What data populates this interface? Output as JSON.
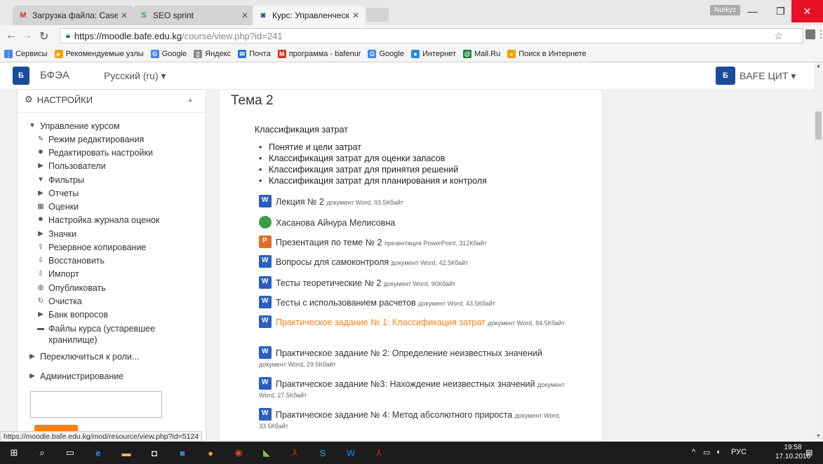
{
  "browser": {
    "tabs": [
      {
        "label": "Загрузка файла: Case-ST",
        "icon": "gmail-icon"
      },
      {
        "label": "SEO sprint",
        "icon": "seosprint-icon"
      },
      {
        "label": "Курс: Управленческий у",
        "icon": "moodle-icon"
      }
    ],
    "user_badge": "Nurkyz",
    "url_host": "https://moodle.bafe.edu.kg",
    "url_path": "/course/view.php?id=241",
    "bookmarks": [
      {
        "label": "Сервисы",
        "icon": "apps-icon",
        "color": "#4285f4"
      },
      {
        "label": "Рекомендуемые узлы",
        "icon": "bookmark-icon",
        "color": "#f0a30a"
      },
      {
        "label": "Google",
        "icon": "google-icon",
        "color": "#4285f4"
      },
      {
        "label": "Яндекс",
        "icon": "page-icon",
        "color": "#888888"
      },
      {
        "label": "Почта",
        "icon": "mail-icon",
        "color": "#2a6fd6"
      },
      {
        "label": "программа - bafenur",
        "icon": "gmail-icon",
        "color": "#d93025"
      },
      {
        "label": "Google",
        "icon": "google-icon",
        "color": "#4285f4"
      },
      {
        "label": "Интернет",
        "icon": "globe-icon",
        "color": "#2a8ad6"
      },
      {
        "label": "Mail.Ru",
        "icon": "mailru-icon",
        "color": "#1a7f3c"
      },
      {
        "label": "Поиск в Интернете",
        "icon": "search-icon",
        "color": "#e8a000"
      }
    ]
  },
  "navbar": {
    "brand": "БФЭА",
    "language": "Русский (ru) ▾",
    "user": "BAFE ЦИТ ▾"
  },
  "settings": {
    "title": "НАСТРОЙКИ",
    "items": [
      {
        "label": "Управление курсом",
        "icon": "expanded-arrow-icon",
        "indent": 0
      },
      {
        "label": "Режим редактирования",
        "icon": "pencil-icon",
        "indent": 1
      },
      {
        "label": "Редактировать настройки",
        "icon": "gear-icon",
        "indent": 1
      },
      {
        "label": "Пользователи",
        "icon": "collapsed-arrow-icon",
        "indent": 1
      },
      {
        "label": "Фильтры",
        "icon": "filter-icon",
        "indent": 1
      },
      {
        "label": "Отчеты",
        "icon": "collapsed-arrow-icon",
        "indent": 1
      },
      {
        "label": "Оценки",
        "icon": "grades-icon",
        "indent": 1
      },
      {
        "label": "Настройка журнала оценок",
        "icon": "gear-icon",
        "indent": 1
      },
      {
        "label": "Значки",
        "icon": "collapsed-arrow-icon",
        "indent": 1
      },
      {
        "label": "Резервное копирование",
        "icon": "backup-icon",
        "indent": 1
      },
      {
        "label": "Восстановить",
        "icon": "restore-icon",
        "indent": 1
      },
      {
        "label": "Импорт",
        "icon": "import-icon",
        "indent": 1
      },
      {
        "label": "Опубликовать",
        "icon": "publish-icon",
        "indent": 1
      },
      {
        "label": "Очистка",
        "icon": "reset-icon",
        "indent": 1
      },
      {
        "label": "Банк вопросов",
        "icon": "collapsed-arrow-icon",
        "indent": 1
      },
      {
        "label": "Файлы курса (устаревшее",
        "icon": "folder-icon",
        "indent": 1
      },
      {
        "label": "хранилище)",
        "icon": "",
        "indent": 2
      },
      {
        "label": "Переключиться к роли...",
        "icon": "collapsed-arrow-icon",
        "indent": 0
      },
      {
        "label": "Администрирование",
        "icon": "collapsed-arrow-icon",
        "indent": 0
      }
    ]
  },
  "section": {
    "title": "Тема 2",
    "summary_title": "Классификация затрат",
    "bullets": [
      "Понятие и цели затрат",
      "Классификация затрат для оценки запасов",
      "Классификация затрат для принятия решений",
      "Классификация затрат для планирования и контроля"
    ],
    "activities": [
      {
        "name": "Лекция № 2",
        "meta": "документ Word, 93.5Кбайт",
        "type": "word",
        "highlight": false
      },
      {
        "name": "Хасанова Айнура Мелисовна",
        "meta": "",
        "type": "url",
        "highlight": false
      },
      {
        "name": "Презентация по теме № 2",
        "meta": "презентация PowerPoint, 312Кбайт",
        "type": "ppt",
        "highlight": false
      },
      {
        "name": "Вопросы для самоконтроля",
        "meta": "документ Word, 42.5Кбайт",
        "type": "word",
        "highlight": false
      },
      {
        "name": "Тесты теоретические № 2",
        "meta": "документ Word, 90Кбайт",
        "type": "word",
        "highlight": false
      },
      {
        "name": "Тесты с использованием расчетов",
        "meta": "документ Word, 43.5Кбайт",
        "type": "word",
        "highlight": false
      },
      {
        "name": "Практическое задание № 1: Классификация затрат",
        "meta": "документ Word, 84.5Кбайт",
        "type": "word",
        "highlight": true
      },
      {
        "name": "Практическое задание № 2: Определение неизвестных значений",
        "meta": "документ Word, 29.5Кбайт",
        "type": "word",
        "highlight": false
      },
      {
        "name": "Практическое задание №3: Нахождение неизвестных значений",
        "meta": "документ Word, 27.5Кбайт",
        "type": "word",
        "highlight": false
      },
      {
        "name": "Практическое задание № 4: Метод абсолютного прироста",
        "meta": "документ Word, 33.5Кбайт",
        "type": "word",
        "highlight": false
      }
    ]
  },
  "status_url": "https://moodle.bafe.edu.kg/mod/resource/view.php?id=5124",
  "taskbar": {
    "lang": "РУС",
    "time": "19:58",
    "date": "17.10.2016"
  },
  "colors": {
    "accent": "#f98012",
    "brand": "#1b4b9b"
  }
}
